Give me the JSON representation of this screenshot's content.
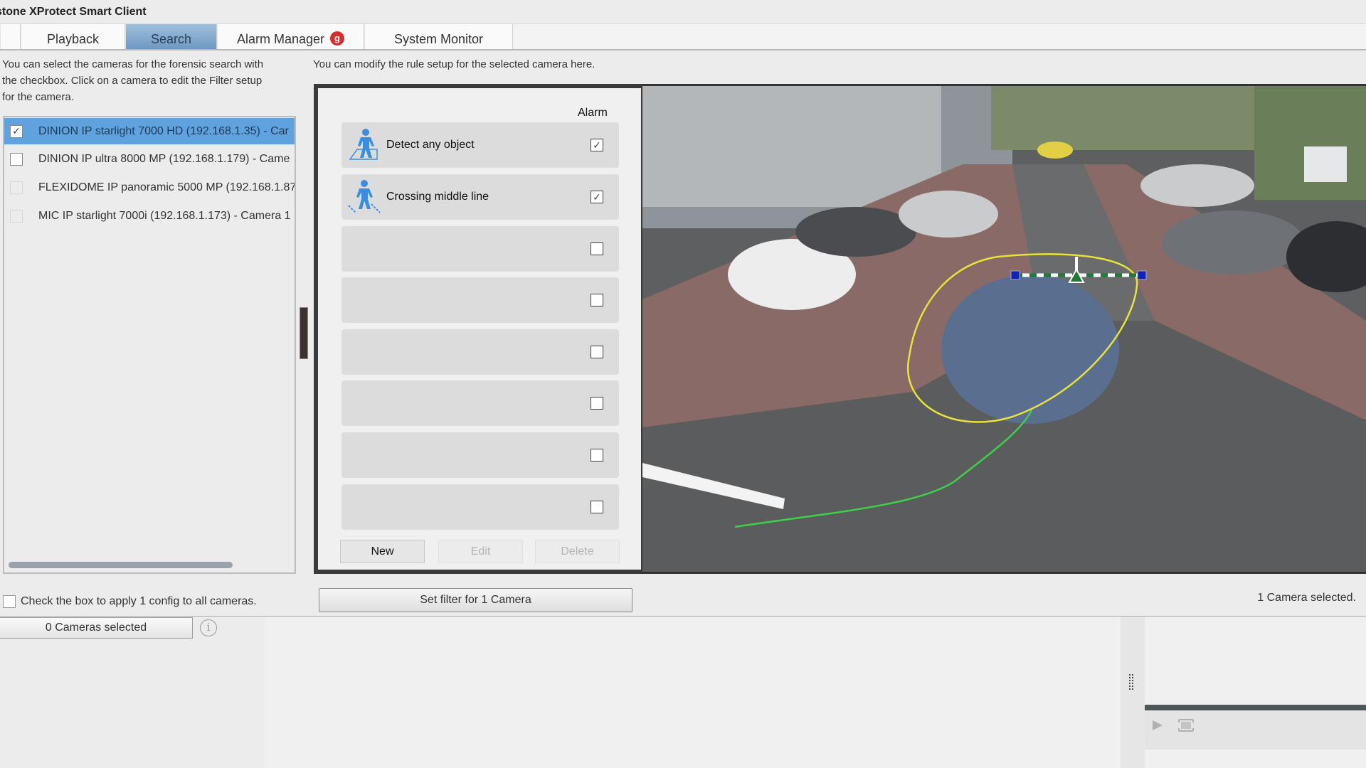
{
  "app": {
    "title": "Milestone XProtect Smart Client",
    "title_visible": "stone XProtect Smart Client"
  },
  "tabs": [
    {
      "label": "",
      "active": false
    },
    {
      "label": "Playback",
      "active": false
    },
    {
      "label": "Search",
      "active": true
    },
    {
      "label": "Alarm Manager",
      "active": false,
      "badge": "g"
    },
    {
      "label": "System Monitor",
      "active": false
    }
  ],
  "left_panel": {
    "instruction": [
      "You can select the cameras for the forensic search with",
      "the checkbox. Click on a camera to edit the Filter setup",
      "for the camera."
    ],
    "cameras": [
      {
        "name": "DINION IP starlight 7000 HD (192.168.1.35) - Car",
        "checked": true,
        "selected": true,
        "enabled": true
      },
      {
        "name": "DINION IP ultra 8000 MP (192.168.1.179) - Came",
        "checked": false,
        "selected": false,
        "enabled": true
      },
      {
        "name": "FLEXIDOME IP panoramic 5000 MP (192.168.1.87",
        "checked": false,
        "selected": false,
        "enabled": false
      },
      {
        "name": "MIC IP starlight 7000i (192.168.1.173) - Camera 1",
        "checked": false,
        "selected": false,
        "enabled": false
      }
    ],
    "apply_all_label": "Check the box to apply 1 config to all cameras.",
    "apply_all_checked": false,
    "cameras_selected_button": "0 Cameras selected",
    "info_icon": "i"
  },
  "rule_panel": {
    "instruction": "You can modify the rule setup for the selected camera here.",
    "alarm_header": "Alarm",
    "rules": [
      {
        "name": "Detect any object",
        "icon": "person-in-area-icon",
        "alarm": true
      },
      {
        "name": "Crossing middle line",
        "icon": "person-crossing-line-icon",
        "alarm": true
      },
      {
        "name": "",
        "icon": "",
        "alarm": false
      },
      {
        "name": "",
        "icon": "",
        "alarm": false
      },
      {
        "name": "",
        "icon": "",
        "alarm": false
      },
      {
        "name": "",
        "icon": "",
        "alarm": false
      },
      {
        "name": "",
        "icon": "",
        "alarm": false
      },
      {
        "name": "",
        "icon": "",
        "alarm": false
      }
    ],
    "buttons": {
      "new": "New",
      "edit": "Edit",
      "delete": "Delete"
    },
    "set_filter_button": "Set filter for 1 Camera"
  },
  "status": {
    "cameras_selected": "1 Camera selected."
  },
  "checkmark": "✓",
  "colors": {
    "accent_tab": "#7aa2c9",
    "selection": "#5fa2dd",
    "rule_icon": "#3a8ee0",
    "line_green": "#1f7a3a",
    "line_handle": "#1122bb",
    "object_outline": "#e8e23a",
    "trajectory": "#3fd04a"
  }
}
